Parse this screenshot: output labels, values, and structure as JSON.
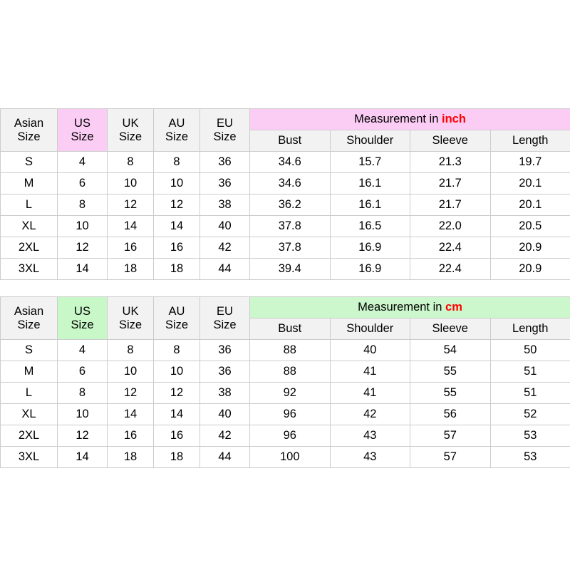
{
  "tables": [
    {
      "id": "inch-table",
      "accent_color": "#fbcdf5",
      "unit_color": "#ff0000",
      "size_headers": [
        {
          "line1": "Asian",
          "line2": "Size"
        },
        {
          "line1": "US",
          "line2": "Size"
        },
        {
          "line1": "UK",
          "line2": "Size"
        },
        {
          "line1": "AU",
          "line2": "Size"
        },
        {
          "line1": "EU",
          "line2": "Size"
        }
      ],
      "banner_prefix": "Measurement in ",
      "banner_unit": "inch",
      "measurement_headers": [
        "Bust",
        "Shoulder",
        "Sleeve",
        "Length"
      ],
      "rows": [
        {
          "asian": "S",
          "us": "4",
          "uk": "8",
          "au": "8",
          "eu": "36",
          "bust": "34.6",
          "shoulder": "15.7",
          "sleeve": "21.3",
          "length": "19.7"
        },
        {
          "asian": "M",
          "us": "6",
          "uk": "10",
          "au": "10",
          "eu": "36",
          "bust": "34.6",
          "shoulder": "16.1",
          "sleeve": "21.7",
          "length": "20.1"
        },
        {
          "asian": "L",
          "us": "8",
          "uk": "12",
          "au": "12",
          "eu": "38",
          "bust": "36.2",
          "shoulder": "16.1",
          "sleeve": "21.7",
          "length": "20.1"
        },
        {
          "asian": "XL",
          "us": "10",
          "uk": "14",
          "au": "14",
          "eu": "40",
          "bust": "37.8",
          "shoulder": "16.5",
          "sleeve": "22.0",
          "length": "20.5"
        },
        {
          "asian": "2XL",
          "us": "12",
          "uk": "16",
          "au": "16",
          "eu": "42",
          "bust": "37.8",
          "shoulder": "16.9",
          "sleeve": "22.4",
          "length": "20.9"
        },
        {
          "asian": "3XL",
          "us": "14",
          "uk": "18",
          "au": "18",
          "eu": "44",
          "bust": "39.4",
          "shoulder": "16.9",
          "sleeve": "22.4",
          "length": "20.9"
        }
      ]
    },
    {
      "id": "cm-table",
      "accent_color": "#c8f7c8",
      "unit_color": "#ff0000",
      "size_headers": [
        {
          "line1": "Asian",
          "line2": "Size"
        },
        {
          "line1": "US",
          "line2": "Size"
        },
        {
          "line1": "UK",
          "line2": "Size"
        },
        {
          "line1": "AU",
          "line2": "Size"
        },
        {
          "line1": "EU",
          "line2": "Size"
        }
      ],
      "banner_prefix": "Measurement in ",
      "banner_unit": "cm",
      "measurement_headers": [
        "Bust",
        "Shoulder",
        "Sleeve",
        "Length"
      ],
      "rows": [
        {
          "asian": "S",
          "us": "4",
          "uk": "8",
          "au": "8",
          "eu": "36",
          "bust": "88",
          "shoulder": "40",
          "sleeve": "54",
          "length": "50"
        },
        {
          "asian": "M",
          "us": "6",
          "uk": "10",
          "au": "10",
          "eu": "36",
          "bust": "88",
          "shoulder": "41",
          "sleeve": "55",
          "length": "51"
        },
        {
          "asian": "L",
          "us": "8",
          "uk": "12",
          "au": "12",
          "eu": "38",
          "bust": "92",
          "shoulder": "41",
          "sleeve": "55",
          "length": "51"
        },
        {
          "asian": "XL",
          "us": "10",
          "uk": "14",
          "au": "14",
          "eu": "40",
          "bust": "96",
          "shoulder": "42",
          "sleeve": "56",
          "length": "52"
        },
        {
          "asian": "2XL",
          "us": "12",
          "uk": "16",
          "au": "16",
          "eu": "42",
          "bust": "96",
          "shoulder": "43",
          "sleeve": "57",
          "length": "53"
        },
        {
          "asian": "3XL",
          "us": "14",
          "uk": "18",
          "au": "18",
          "eu": "44",
          "bust": "100",
          "shoulder": "43",
          "sleeve": "57",
          "length": "53"
        }
      ]
    }
  ]
}
